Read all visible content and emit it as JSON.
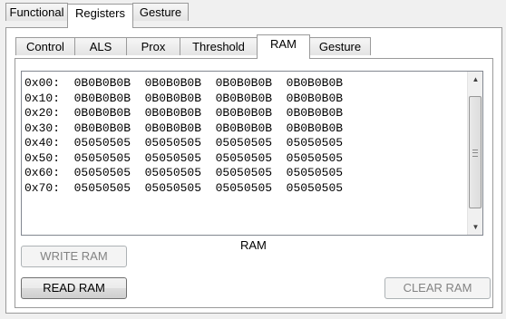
{
  "outer_tabs": [
    "Functional",
    "Registers",
    "Gesture"
  ],
  "outer_active": "Registers",
  "inner_tabs": [
    "Control",
    "ALS",
    "Prox",
    "Threshold",
    "RAM",
    "Gesture"
  ],
  "inner_active": "RAM",
  "ram_lines": [
    "0x00:  0B0B0B0B  0B0B0B0B  0B0B0B0B  0B0B0B0B",
    "0x10:  0B0B0B0B  0B0B0B0B  0B0B0B0B  0B0B0B0B",
    "0x20:  0B0B0B0B  0B0B0B0B  0B0B0B0B  0B0B0B0B",
    "0x30:  0B0B0B0B  0B0B0B0B  0B0B0B0B  0B0B0B0B",
    "0x40:  05050505  05050505  05050505  05050505",
    "0x50:  05050505  05050505  05050505  05050505",
    "0x60:  05050505  05050505  05050505  05050505",
    "0x70:  05050505  05050505  05050505  05050505"
  ],
  "ram_label": "RAM",
  "buttons": {
    "write_ram": "WRITE RAM",
    "read_ram": "READ RAM",
    "clear_ram": "CLEAR RAM"
  },
  "icons": {
    "scroll_up": "scroll-up-arrow-icon",
    "scroll_down": "scroll-down-arrow-icon"
  }
}
